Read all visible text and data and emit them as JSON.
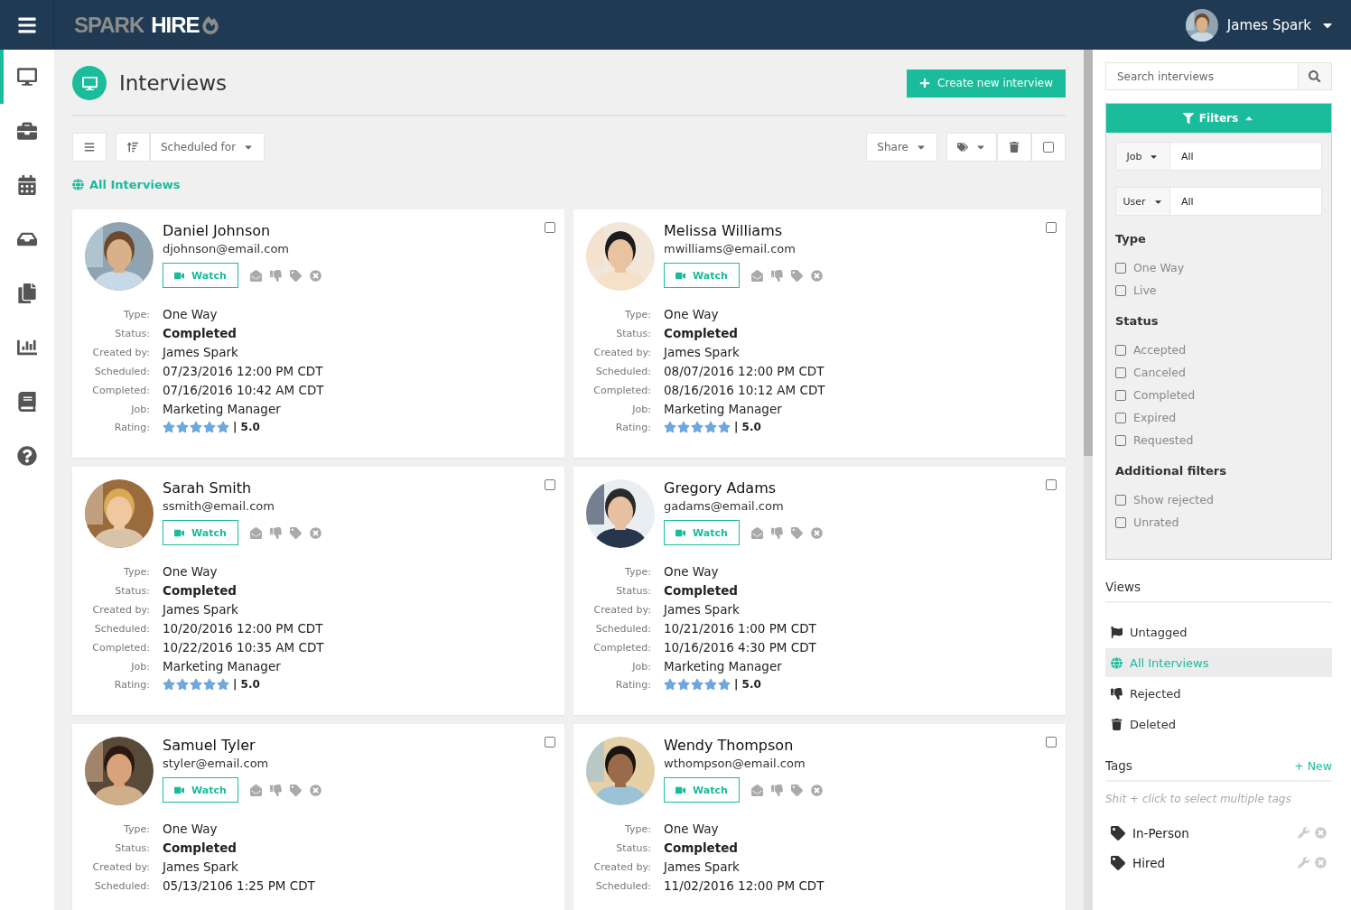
{
  "header": {
    "logo_first": "SPARK",
    "logo_second": "HIRE",
    "user_name": "James Spark"
  },
  "nav": [
    {
      "selected": true
    },
    {
      "selected": false
    },
    {
      "selected": false
    },
    {
      "selected": false
    },
    {
      "selected": false
    },
    {
      "selected": false
    },
    {
      "selected": false
    },
    {
      "selected": false
    }
  ],
  "page": {
    "title": "Interviews",
    "create_button": "Create new interview"
  },
  "toolbar": {
    "sort_label": "Scheduled for",
    "share_label": "Share",
    "select_all_checked": false
  },
  "view_label": "All Interviews",
  "cards": [
    {
      "name": "Daniel Johnson",
      "email": "djohnson@email.com",
      "watch": "Watch",
      "checked": false,
      "fields": [
        {
          "label": "Type:",
          "value": "One Way"
        },
        {
          "label": "Status:",
          "value": "Completed",
          "kind": "bold"
        },
        {
          "label": "Created by:",
          "value": "James Spark"
        },
        {
          "label": "Scheduled:",
          "value": "07/23/2016 12:00 PM CDT"
        },
        {
          "label": "Completed:",
          "value": "07/16/2016 10:42 AM CDT"
        },
        {
          "label": "Job:",
          "value": "Marketing Manager"
        }
      ],
      "rating_label": "Rating:",
      "stars": 5,
      "rating": "| 5.0"
    },
    {
      "name": "Melissa Williams",
      "email": "mwilliams@email.com",
      "watch": "Watch",
      "checked": false,
      "fields": [
        {
          "label": "Type:",
          "value": "One Way"
        },
        {
          "label": "Status:",
          "value": "Completed",
          "kind": "bold"
        },
        {
          "label": "Created by:",
          "value": "James Spark"
        },
        {
          "label": "Scheduled:",
          "value": "08/07/2016 12:00 PM CDT"
        },
        {
          "label": "Completed:",
          "value": "08/16/2016 10:12 AM CDT"
        },
        {
          "label": "Job:",
          "value": "Marketing Manager"
        }
      ],
      "rating_label": "Rating:",
      "stars": 5,
      "rating": "| 5.0"
    },
    {
      "name": "Sarah Smith",
      "email": "ssmith@email.com",
      "watch": "Watch",
      "checked": false,
      "fields": [
        {
          "label": "Type:",
          "value": "One Way"
        },
        {
          "label": "Status:",
          "value": "Completed",
          "kind": "bold"
        },
        {
          "label": "Created by:",
          "value": "James Spark"
        },
        {
          "label": "Scheduled:",
          "value": "10/20/2016 12:00 PM CDT"
        },
        {
          "label": "Completed:",
          "value": "10/22/2016 10:35 AM CDT"
        },
        {
          "label": "Job:",
          "value": "Marketing Manager"
        }
      ],
      "rating_label": "Rating:",
      "stars": 5,
      "rating": "| 5.0"
    },
    {
      "name": "Gregory Adams",
      "email": "gadams@email.com",
      "watch": "Watch",
      "checked": false,
      "fields": [
        {
          "label": "Type:",
          "value": "One Way"
        },
        {
          "label": "Status:",
          "value": "Completed",
          "kind": "bold"
        },
        {
          "label": "Created by:",
          "value": "James Spark"
        },
        {
          "label": "Scheduled:",
          "value": "10/21/2016 1:00 PM CDT"
        },
        {
          "label": "Completed:",
          "value": "10/16/2016 4:30 PM CDT"
        },
        {
          "label": "Job:",
          "value": "Marketing Manager"
        }
      ],
      "rating_label": "Rating:",
      "stars": 5,
      "rating": "| 5.0"
    },
    {
      "name": "Samuel Tyler",
      "email": "styler@email.com",
      "watch": "Watch",
      "checked": false,
      "fields": [
        {
          "label": "Type:",
          "value": "One Way"
        },
        {
          "label": "Status:",
          "value": "Completed",
          "kind": "bold"
        },
        {
          "label": "Created by:",
          "value": "James Spark"
        },
        {
          "label": "Scheduled:",
          "value": "05/13/2106 1:25 PM CDT"
        }
      ]
    },
    {
      "name": "Wendy Thompson",
      "email": "wthompson@email.com",
      "watch": "Watch",
      "checked": false,
      "fields": [
        {
          "label": "Type:",
          "value": "One Way"
        },
        {
          "label": "Status:",
          "value": "Completed",
          "kind": "bold"
        },
        {
          "label": "Created by:",
          "value": "James Spark"
        },
        {
          "label": "Scheduled:",
          "value": "11/02/2016 12:00 PM CDT"
        }
      ]
    }
  ],
  "sidebar": {
    "search": {
      "placeholder": "Search interviews"
    },
    "filters_label": "Filters",
    "expanded": true,
    "selects": [
      {
        "label": "Job",
        "value": "All"
      },
      {
        "label": "User",
        "value": "All"
      }
    ],
    "groups": [
      {
        "title": "Type",
        "options": [
          {
            "label": "One Way",
            "checked": false
          },
          {
            "label": "Live",
            "checked": false
          }
        ]
      },
      {
        "title": "Status",
        "options": [
          {
            "label": "Accepted",
            "checked": false
          },
          {
            "label": "Canceled",
            "checked": false
          },
          {
            "label": "Completed",
            "checked": false
          },
          {
            "label": "Expired",
            "checked": false
          },
          {
            "label": "Requested",
            "checked": false
          }
        ]
      },
      {
        "title": "Additional filters",
        "options": [
          {
            "label": "Show rejected",
            "checked": false
          },
          {
            "label": "Unrated",
            "checked": false
          }
        ]
      }
    ],
    "views_title": "Views",
    "views": [
      {
        "label": "Untagged",
        "kind": "flag",
        "selected": false
      },
      {
        "label": "All Interviews",
        "kind": "globe",
        "selected": true
      },
      {
        "label": "Rejected",
        "kind": "thumbsdown",
        "selected": false
      },
      {
        "label": "Deleted",
        "kind": "trash",
        "selected": false
      }
    ],
    "tags_title": "Tags",
    "new_tag": "+ New",
    "tags_hint": "Shit + click to select multiple tags",
    "tags": [
      {
        "label": "In-Person"
      },
      {
        "label": "Hired"
      }
    ]
  }
}
